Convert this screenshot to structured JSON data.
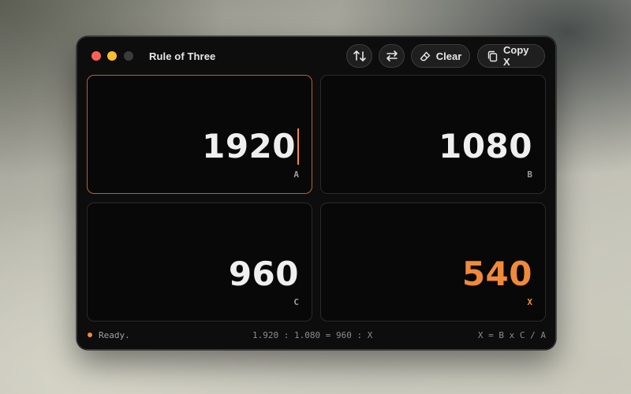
{
  "window": {
    "title": "Rule of Three"
  },
  "toolbar": {
    "swap_vertical_label": "",
    "swap_horizontal_label": "",
    "clear_label": "Clear",
    "copy_label": "Copy X"
  },
  "fields": {
    "a": {
      "value": "1920",
      "tag": "A"
    },
    "b": {
      "value": "1080",
      "tag": "B"
    },
    "c": {
      "value": "960",
      "tag": "C"
    },
    "x": {
      "value": "540",
      "tag": "X"
    }
  },
  "status": {
    "text": "Ready.",
    "equation": "1.920 : 1.080 = 960 : X",
    "formula": "X = B x C / A"
  },
  "colors": {
    "accent": "#f08a3a",
    "active_border": "#b8642a",
    "close": "#fe5f57",
    "minimize": "#febc2e"
  },
  "icons": [
    "swap-vertical-icon",
    "swap-horizontal-icon",
    "eraser-icon",
    "copy-icon"
  ]
}
